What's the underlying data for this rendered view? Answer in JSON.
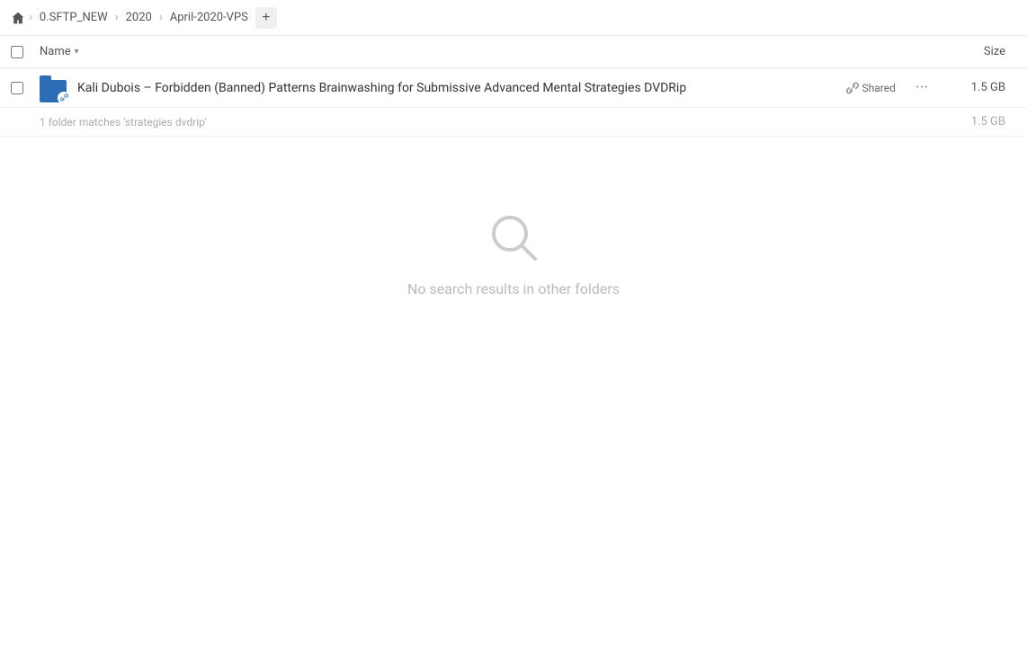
{
  "breadcrumb": {
    "home_icon": "🏠",
    "items": [
      {
        "label": "0.SFTP_NEW",
        "id": "sftp"
      },
      {
        "label": "2020",
        "id": "2020"
      },
      {
        "label": "April-2020-VPS",
        "id": "april-2020-vps"
      }
    ],
    "add_label": "+"
  },
  "column_headers": {
    "name_label": "Name",
    "chevron": "▾",
    "size_label": "Size"
  },
  "file_row": {
    "name": "Kali Dubois – Forbidden (Banned) Patterns Brainwashing for Submissive Advanced Mental Strategies DVDRip",
    "shared_label": "Shared",
    "size": "1.5 GB"
  },
  "summary": {
    "text": "1 folder matches 'strategies dvdrip'",
    "size": "1.5 GB"
  },
  "empty_state": {
    "message": "No search results in other folders"
  }
}
